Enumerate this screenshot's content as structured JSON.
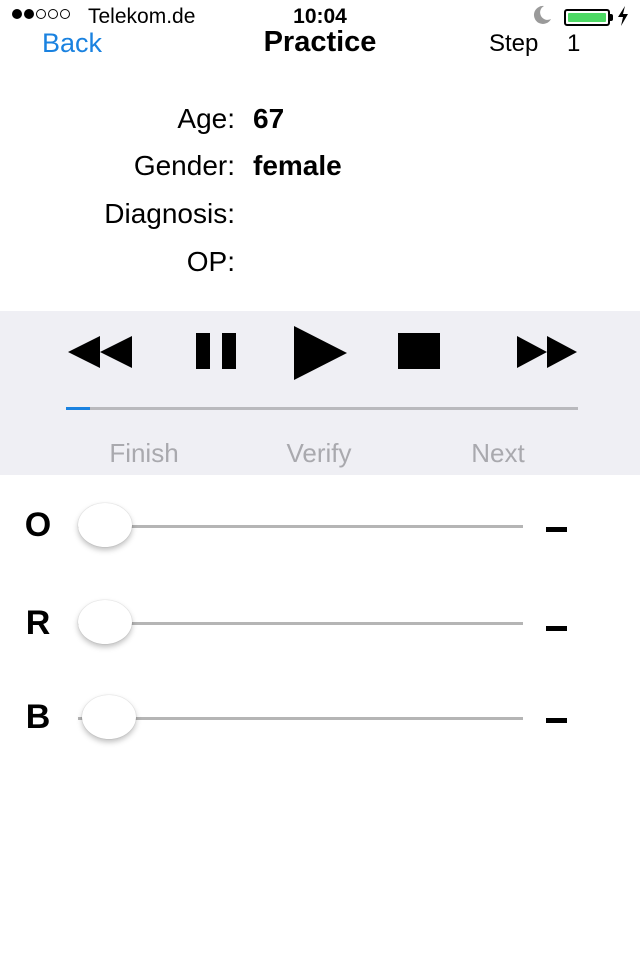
{
  "status_bar": {
    "carrier": "Telekom.de",
    "time": "10:04",
    "signal_bars_filled": 2,
    "signal_bars_total": 5,
    "battery_level": 1.0,
    "battery_color": "#4cd964"
  },
  "nav": {
    "back_label": "Back",
    "title": "Practice",
    "step_label": "Step",
    "step_value": "1",
    "accent_color": "#1a82e0"
  },
  "patient": {
    "age_label": "Age:",
    "age_value": "67",
    "gender_label": "Gender:",
    "gender_value": "female",
    "diagnosis_label": "Diagnosis:",
    "diagnosis_value": "",
    "op_label": "OP:",
    "op_value": ""
  },
  "player": {
    "progress": 0.047,
    "controls": [
      "rewind-icon",
      "pause-icon",
      "play-icon",
      "stop-icon",
      "fast-forward-icon"
    ],
    "finish_label": "Finish",
    "verify_label": "Verify",
    "next_label": "Next"
  },
  "sliders": [
    {
      "label": "O",
      "value": 0,
      "value_text": "-"
    },
    {
      "label": "R",
      "value": 0,
      "value_text": "-"
    },
    {
      "label": "B",
      "value": 0.01,
      "value_text": "-"
    }
  ]
}
